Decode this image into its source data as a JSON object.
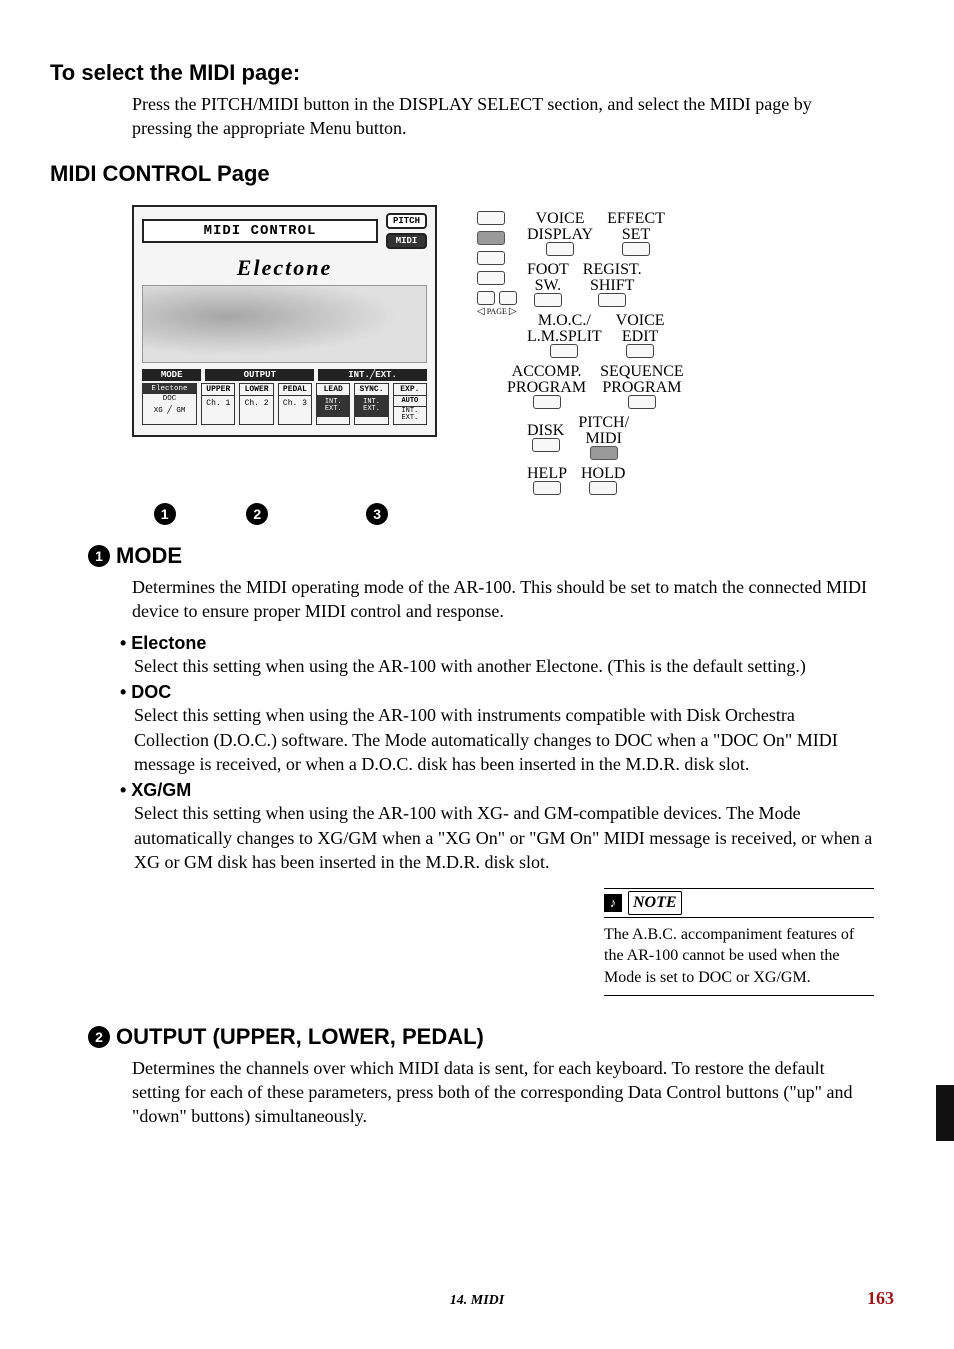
{
  "headings": {
    "h1": "To select the MIDI page:",
    "h2": "MIDI CONTROL Page",
    "mode_hdr": "MODE",
    "output_hdr": "OUTPUT (UPPER, LOWER, PEDAL)"
  },
  "intro_text": "Press the PITCH/MIDI button in the DISPLAY SELECT section, and select the MIDI page by pressing the appropriate Menu button.",
  "lcd": {
    "title": "MIDI CONTROL",
    "side_pitch": "PITCH",
    "side_midi": "MIDI",
    "logo": "Electone",
    "hdr_mode": "MODE",
    "hdr_output": "OUTPUT",
    "hdr_intext": "INT.╱EXT.",
    "sub_upper": "UPPER",
    "sub_lower": "LOWER",
    "sub_pedal": "PEDAL",
    "sub_lead": "LEAD",
    "sub_sync": "SYNC.",
    "sub_exp": "EXP.",
    "mode_electone": "Electone",
    "mode_doc": "DOC",
    "mode_xg": "XG ╱ GM",
    "ch1": "Ch. 1",
    "ch2": "Ch. 2",
    "ch3": "Ch. 3",
    "intext_val": "INT.\nEXT.",
    "auto_label": "AUTO"
  },
  "callouts": {
    "c1": "1",
    "c2": "2",
    "c3": "3"
  },
  "dc_panel": {
    "voice_display": "VOICE\nDISPLAY",
    "effect_set": "EFFECT\nSET",
    "foot_sw": "FOOT\nSW.",
    "regist_shift": "REGIST.\nSHIFT",
    "moc": "M.O.C./\nL.M.SPLIT",
    "voice_edit": "VOICE\nEDIT",
    "accomp": "ACCOMP.\nPROGRAM",
    "seq": "SEQUENCE\nPROGRAM",
    "page": "PAGE",
    "disk": "DISK",
    "pitch_midi": "PITCH/\nMIDI",
    "help": "HELP",
    "hold": "HOLD"
  },
  "mode_desc": "Determines the MIDI operating mode of the AR-100.  This should be set to match the connected MIDI device to ensure proper MIDI control and response.",
  "items": {
    "electone": {
      "label": "• Electone",
      "text": "Select this setting when using the AR-100 with another Electone.  (This is the default setting.)"
    },
    "doc": {
      "label": "• DOC",
      "text": "Select this setting when using the AR-100 with instruments compatible with Disk Orchestra Collection (D.O.C.) software.  The Mode automatically changes to DOC when a \"DOC On\" MIDI message is received, or when a D.O.C. disk has been inserted in the M.D.R. disk slot."
    },
    "xg": {
      "label": "• XG/GM",
      "text": "Select this setting when using the AR-100 with XG- and GM-compatible devices.  The Mode automatically changes to XG/GM when a \"XG On\" or \"GM On\" MIDI message is received, or when a XG or GM disk has been inserted in the M.D.R. disk slot."
    }
  },
  "note": {
    "label": "NOTE",
    "text": "The A.B.C. accompaniment features of the AR-100 cannot be used when the Mode is set to DOC or XG/GM."
  },
  "output_desc": "Determines the channels over which MIDI data is sent, for each keyboard.  To restore the default setting for each of these parameters, press both of the corresponding Data Control buttons (\"up\" and \"down\" buttons) simultaneously.",
  "footer": {
    "chapter": "14. MIDI",
    "page": "163"
  }
}
